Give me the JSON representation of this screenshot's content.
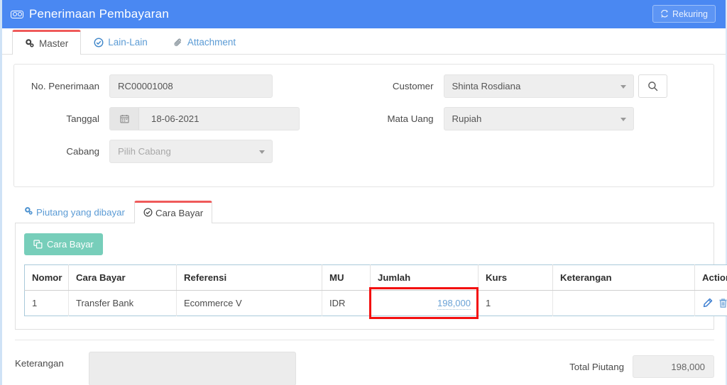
{
  "window": {
    "title": "Penerimaan Pembayaran",
    "title_icon": "money-bill-icon",
    "header_color": "#4a88f2",
    "rekuring_label": "Rekuring",
    "rekuring_icon": "refresh-sync-icon"
  },
  "tabs": [
    {
      "label": "Master",
      "icon": "cogs-icon",
      "active": true
    },
    {
      "label": "Lain-Lain",
      "icon": "check-circle-icon",
      "active": false
    },
    {
      "label": "Attachment",
      "icon": "paperclip-icon",
      "active": false
    }
  ],
  "form": {
    "left": [
      {
        "label": "No. Penerimaan",
        "value": "RC00001008",
        "placeholder": "",
        "type": "text"
      },
      {
        "label": "Tanggal",
        "value": "18-06-2021",
        "placeholder": "",
        "type": "date",
        "icon": "calendar-icon"
      },
      {
        "label": "Cabang",
        "value": "",
        "placeholder": "Pilih Cabang",
        "type": "select"
      }
    ],
    "right": [
      {
        "label": "Customer",
        "value": "Shinta Rosdiana",
        "placeholder": "",
        "type": "select",
        "search_icon": "search-icon"
      },
      {
        "label": "Mata Uang",
        "value": "Rupiah",
        "placeholder": "",
        "type": "select"
      }
    ]
  },
  "subtabs": [
    {
      "label": "Piutang yang dibayar",
      "icon": "cogs-icon",
      "active": false
    },
    {
      "label": "Cara Bayar",
      "icon": "check-circle-icon",
      "active": true
    }
  ],
  "toolbar": {
    "cara_bayar_label": "Cara Bayar",
    "cara_bayar_icon": "copy-clone-icon",
    "cara_bayar_color": "#77ceba"
  },
  "table": {
    "columns": [
      "Nomor",
      "Cara Bayar",
      "Referensi",
      "MU",
      "Jumlah",
      "Kurs",
      "Keterangan",
      "Action"
    ],
    "rows": [
      {
        "nomor": "1",
        "cara_bayar": "Transfer Bank",
        "referensi": "Ecommerce V",
        "mu": "IDR",
        "jumlah": "198,000",
        "kurs": "1",
        "keterangan": "",
        "edit_icon": "pencil-icon",
        "delete_icon": "trash-icon"
      }
    ],
    "highlight": {
      "cell": "jumlah",
      "row": 0,
      "color": "#f30f0f"
    }
  },
  "footer": {
    "keterangan_label": "Keterangan",
    "keterangan_value": "",
    "total_piutang_label": "Total Piutang",
    "total_piutang_value": "198,000"
  }
}
